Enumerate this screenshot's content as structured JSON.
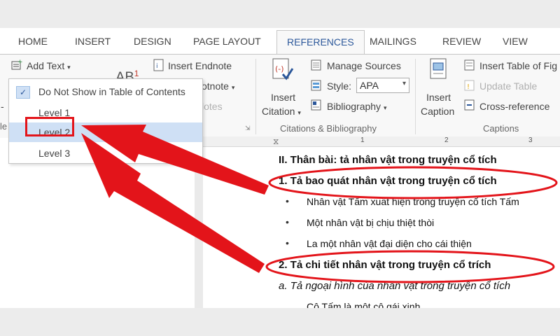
{
  "tabs": [
    "HOME",
    "INSERT",
    "DESIGN",
    "PAGE LAYOUT",
    "REFERENCES",
    "MAILINGS",
    "REVIEW",
    "VIEW"
  ],
  "active_tab": "REFERENCES",
  "toc_group": {
    "add_text": "Add Text",
    "insert_endnote": "Insert Endnote",
    "footnote_partial": "otnote",
    "notes_partial": "lotes",
    "ab_label": "AB",
    "ab_sup": "1"
  },
  "citations_group": {
    "insert_citation_1": "Insert",
    "insert_citation_2": "Citation",
    "manage_sources": "Manage Sources",
    "style_label": "Style:",
    "style_value": "APA",
    "bibliography": "Bibliography",
    "group_label": "Citations & Bibliography"
  },
  "captions_group": {
    "insert_caption_1": "Insert",
    "insert_caption_2": "Caption",
    "insert_table_of_figures": "Insert Table of Fig",
    "update_table": "Update Table",
    "cross_reference": "Cross-reference",
    "group_label": "Captions"
  },
  "left_partial": {
    "dash": "-",
    "le": "le"
  },
  "dropdown_menu": {
    "items": [
      "Do Not Show in Table of Contents",
      "Level 1",
      "Level 2",
      "Level 3"
    ],
    "checked_index": 0,
    "highlighted_index": 2
  },
  "ruler": {
    "marks": [
      "1",
      "2",
      "3"
    ]
  },
  "document": {
    "heading": "II.  Thân bài: tả nhân vật trong truyện cổ tích",
    "item1": "1. Tả bao quát nhân vật trong truyện cổ tích",
    "bullets": [
      "Nhân vật Tấm xuất hiện trong truyện cổ tích Tấm",
      "Một nhân vật bị chịu thiệt thòi",
      "La một nhân vật đại diện cho cái thiện"
    ],
    "item2": "2. Tả chi tiết nhân vật trong truyện cổ trích",
    "item_a": "a. Tả ngoại hình của nhân vật trong truyện cổ tích",
    "cut_line": "Cô Tấm là một cô gái xinh"
  },
  "colors": {
    "accent": "#2b579a",
    "annotation_red": "#e3141a",
    "menu_highlight": "#cfe0f5"
  }
}
